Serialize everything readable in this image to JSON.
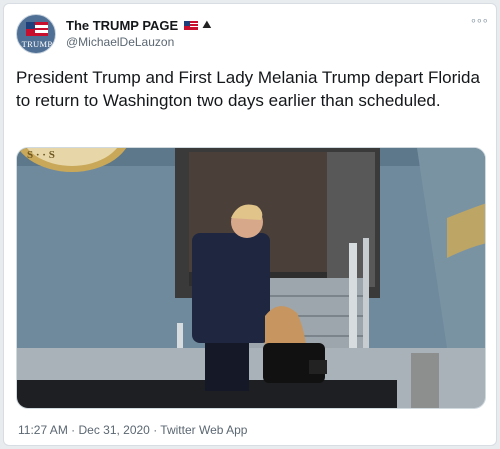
{
  "account": {
    "display_name": "The TRUMP PAGE",
    "handle": "@MichaelDeLauzon",
    "avatar_label": "TRUMP"
  },
  "icons": {
    "flag": "us-flag-icon",
    "eagle": "eagle-icon",
    "more": "more-options-icon"
  },
  "tweet": {
    "text": "President Trump and First Lady Melania Trump depart Florida to return to Washington two days earlier than scheduled."
  },
  "media": {
    "description": "photo-tweet-image"
  },
  "meta": {
    "timestamp": "11:27 AM · Dec 31, 2020 · Twitter Web App"
  },
  "colors": {
    "text": "#14171a",
    "secondary": "#5b6772",
    "plane_body": "#6f8799",
    "door_frame": "#3a3a3a"
  }
}
